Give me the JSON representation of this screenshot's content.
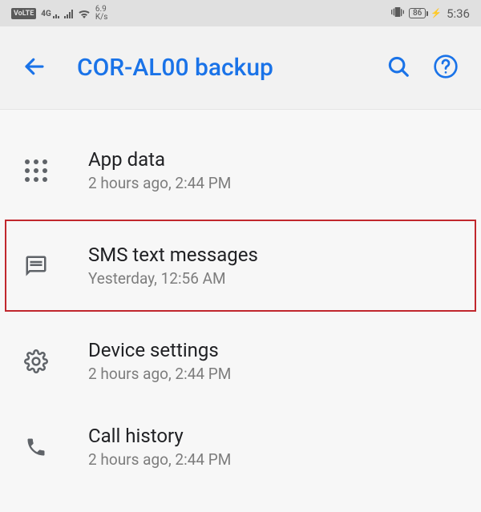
{
  "status_bar": {
    "volte": "VoLTE",
    "network_type": "4G",
    "speed_value": "6.9",
    "speed_unit": "K/s",
    "battery_percent": "86",
    "time": "5:36"
  },
  "app_bar": {
    "title": "COR-AL00 backup"
  },
  "list": {
    "items": [
      {
        "icon": "apps",
        "title": "App data",
        "subtitle": "2 hours ago, 2:44 PM",
        "highlighted": false
      },
      {
        "icon": "message",
        "title": "SMS text messages",
        "subtitle": "Yesterday, 12:56 AM",
        "highlighted": true
      },
      {
        "icon": "settings",
        "title": "Device settings",
        "subtitle": "2 hours ago, 2:44 PM",
        "highlighted": false
      },
      {
        "icon": "phone",
        "title": "Call history",
        "subtitle": "2 hours ago, 2:44 PM",
        "highlighted": false
      }
    ]
  }
}
